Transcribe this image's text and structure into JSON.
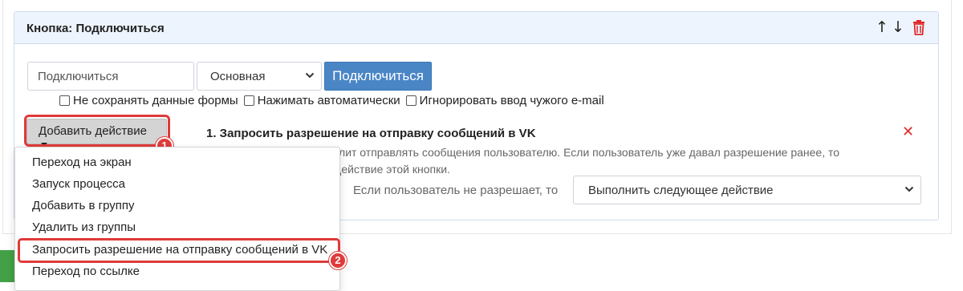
{
  "panel": {
    "title": "Кнопка: Подключиться",
    "icons": [
      "arrow-up-icon",
      "arrow-down-icon",
      "trash-icon"
    ],
    "up_glyph": "↑",
    "down_glyph": "↓"
  },
  "button_config": {
    "text_input_value": "Подключиться",
    "style_select_value": "Основная",
    "preview_button_label": "Подключиться",
    "checkboxes": [
      {
        "label": "Не сохранять данные формы",
        "checked": false
      },
      {
        "label": "Нажимать автоматически",
        "checked": false
      },
      {
        "label": "Игнорировать ввод чужого e-mail",
        "checked": false
      }
    ]
  },
  "add_action": {
    "label": "Добавить действие",
    "annotation_1": "1",
    "menu_items": [
      "Переход на экран",
      "Запуск процесса",
      "Добавить в группу",
      "Удалить из группы",
      "Запросить разрешение на отправку сообщений в VK",
      "Переход по ссылке"
    ],
    "annotation_2": "2"
  },
  "action": {
    "title": "1. Запросить разрешение на отправку сообщений в VK",
    "close_glyph": "✕",
    "description_line1": "Пользователь в VK позволит отправлять сообщения пользователю. Если пользователь уже давал разрешение ранее, то",
    "description_line2": "выполнится следующее действие этой кнопки.",
    "condition_label": "Если пользователь не разрешает, то",
    "condition_value": "Выполнить следующее действие"
  },
  "colors": {
    "primary_button": "#4a86c6",
    "header_bg": "#edf4fd",
    "highlight": "#e03a3a",
    "delete": "#e02828"
  }
}
